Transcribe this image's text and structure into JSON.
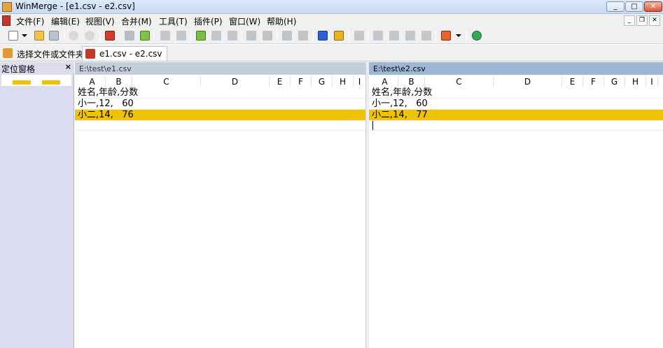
{
  "window": {
    "title": "WinMerge - [e1.csv - e2.csv]",
    "minimize": "_",
    "maximize": "□",
    "close": "✕"
  },
  "menu": [
    "文件(F)",
    "编辑(E)",
    "视图(V)",
    "合并(M)",
    "工具(T)",
    "插件(P)",
    "窗口(W)",
    "帮助(H)"
  ],
  "mdi_controls": {
    "minimize": "_",
    "restore": "❐",
    "close": "✕"
  },
  "tabs": [
    {
      "label": "选择文件或文件夹",
      "icon": "open-folder-icon",
      "active": false
    },
    {
      "label": "e1.csv - e2.csv",
      "icon": "csv-document-icon",
      "active": true
    }
  ],
  "location_pane": {
    "title": "定位窗格",
    "close": "×"
  },
  "left_pane": {
    "path": "E:\\test\\e1.csv",
    "columns": [
      "A",
      "B",
      "C",
      "D",
      "E",
      "F",
      "G",
      "H",
      "I"
    ],
    "rows": [
      {
        "text": "姓名,年龄,分数",
        "diff": false
      },
      {
        "text": "小一,12,   60",
        "diff": false
      },
      {
        "text": "小二,14,   76",
        "diff": true
      }
    ]
  },
  "right_pane": {
    "path": "E:\\test\\e2.csv",
    "columns": [
      "A",
      "B",
      "C",
      "D",
      "E",
      "F",
      "G",
      "H",
      "I"
    ],
    "rows": [
      {
        "text": "姓名,年龄,分数",
        "diff": false
      },
      {
        "text": "小一,12,   60",
        "diff": false
      },
      {
        "text": "小二,14,   77",
        "diff": true
      }
    ]
  },
  "colors": {
    "diff_highlight": "#efc300",
    "location_pane_bg": "#dcdcf0",
    "active_path_header": "#9cb6d6",
    "inactive_path_header": "#c4cedb"
  }
}
